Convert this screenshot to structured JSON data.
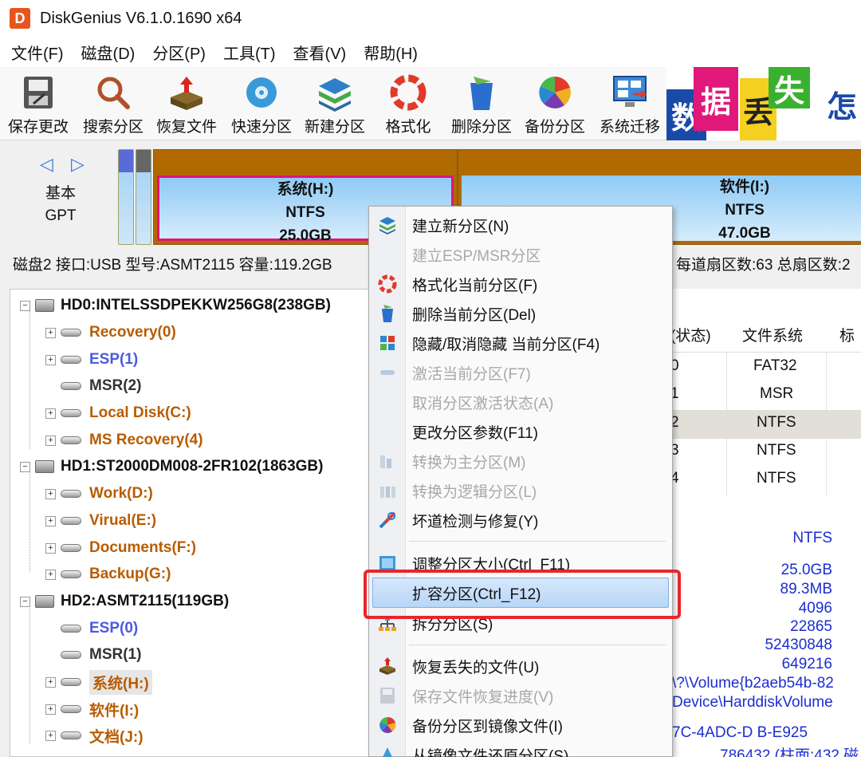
{
  "title": "DiskGenius V6.1.0.1690 x64",
  "menu": [
    "文件(F)",
    "磁盘(D)",
    "分区(P)",
    "工具(T)",
    "查看(V)",
    "帮助(H)"
  ],
  "toolbar": [
    {
      "label": "保存更改",
      "icon": "save-icon"
    },
    {
      "label": "搜索分区",
      "icon": "search-icon"
    },
    {
      "label": "恢复文件",
      "icon": "recover-icon"
    },
    {
      "label": "快速分区",
      "icon": "quick-partition-icon"
    },
    {
      "label": "新建分区",
      "icon": "new-partition-icon"
    },
    {
      "label": "格式化",
      "icon": "format-icon"
    },
    {
      "label": "删除分区",
      "icon": "delete-icon"
    },
    {
      "label": "备份分区",
      "icon": "backup-icon"
    },
    {
      "label": "系统迁移",
      "icon": "migrate-icon"
    }
  ],
  "banner": [
    "数",
    "据",
    "丢",
    "失",
    "怎"
  ],
  "diskmap": {
    "arrows": "◁ ▷",
    "type_line1": "基本",
    "type_line2": "GPT",
    "partitions": [
      {
        "name": "系统(H:)",
        "fs": "NTFS",
        "size": "25.0GB"
      },
      {
        "name": "软件(I:)",
        "fs": "NTFS",
        "size": "47.0GB"
      }
    ]
  },
  "infoline": {
    "left": "磁盘2 接口:USB  型号:ASMT2115  容量:119.2GB",
    "right": "每道扇区数:63  总扇区数:2"
  },
  "tree": [
    {
      "label": "HD0:INTELSSDPEKKW256G8(238GB)",
      "kind": "disk"
    },
    {
      "label": "Recovery(0)",
      "kind": "part",
      "color": "orange"
    },
    {
      "label": "ESP(1)",
      "kind": "part",
      "color": "blue"
    },
    {
      "label": "MSR(2)",
      "kind": "part",
      "color": "dark"
    },
    {
      "label": "Local Disk(C:)",
      "kind": "part",
      "color": "orange"
    },
    {
      "label": "MS Recovery(4)",
      "kind": "part",
      "color": "orange"
    },
    {
      "label": "HD1:ST2000DM008-2FR102(1863GB)",
      "kind": "disk"
    },
    {
      "label": "Work(D:)",
      "kind": "part",
      "color": "orange"
    },
    {
      "label": "Virual(E:)",
      "kind": "part",
      "color": "orange"
    },
    {
      "label": "Documents(F:)",
      "kind": "part",
      "color": "orange"
    },
    {
      "label": "Backup(G:)",
      "kind": "part",
      "color": "orange"
    },
    {
      "label": "HD2:ASMT2115(119GB)",
      "kind": "disk"
    },
    {
      "label": "ESP(0)",
      "kind": "part",
      "color": "blue"
    },
    {
      "label": "MSR(1)",
      "kind": "part",
      "color": "dark"
    },
    {
      "label": "系统(H:)",
      "kind": "part",
      "color": "orange",
      "selected": true
    },
    {
      "label": "软件(I:)",
      "kind": "part",
      "color": "orange"
    },
    {
      "label": "文档(J:)",
      "kind": "part",
      "color": "orange"
    }
  ],
  "table": {
    "headers": [
      "(状态)",
      "文件系统",
      "标"
    ],
    "rows": [
      {
        "idx": "0",
        "fs": "FAT32"
      },
      {
        "idx": "1",
        "fs": "MSR"
      },
      {
        "idx": "2",
        "fs": "NTFS"
      },
      {
        "idx": "3",
        "fs": "NTFS"
      },
      {
        "idx": "4",
        "fs": "NTFS"
      }
    ]
  },
  "details": {
    "fs": "NTFS",
    "values": [
      "25.0GB",
      "89.3MB",
      "4096",
      "22865",
      "52430848",
      "649216"
    ],
    "volume": "\\?\\Volume{b2aeb54b-82",
    "device": "Device\\HarddiskVolume",
    "guid": "7C-4ADC-D",
    "guid_tail": "B-E925",
    "last": "786432 (柱面:432 磁"
  },
  "context_menu": [
    {
      "label": "建立新分区(N)",
      "enabled": true,
      "icon": "new-partition-icon"
    },
    {
      "label": "建立ESP/MSR分区",
      "enabled": false,
      "icon": ""
    },
    {
      "label": "格式化当前分区(F)",
      "enabled": true,
      "icon": "format-icon"
    },
    {
      "label": "删除当前分区(Del)",
      "enabled": true,
      "icon": "delete-icon"
    },
    {
      "label": "隐藏/取消隐藏 当前分区(F4)",
      "enabled": true,
      "icon": "hide-icon"
    },
    {
      "label": "激活当前分区(F7)",
      "enabled": false,
      "icon": "activate-icon"
    },
    {
      "label": "取消分区激活状态(A)",
      "enabled": false,
      "icon": ""
    },
    {
      "label": "更改分区参数(F11)",
      "enabled": true,
      "icon": ""
    },
    {
      "label": "转换为主分区(M)",
      "enabled": false,
      "icon": "primary-icon"
    },
    {
      "label": "转换为逻辑分区(L)",
      "enabled": false,
      "icon": "logical-icon"
    },
    {
      "label": "坏道检测与修复(Y)",
      "enabled": true,
      "icon": "repair-icon"
    },
    {
      "label": "调整分区大小(Ctrl_F11)",
      "enabled": true,
      "icon": "resize-icon"
    },
    {
      "label": "扩容分区(Ctrl_F12)",
      "enabled": true,
      "icon": "",
      "highlighted": true
    },
    {
      "label": "拆分分区(S)",
      "enabled": true,
      "icon": "split-icon"
    },
    {
      "label": "恢复丢失的文件(U)",
      "enabled": true,
      "icon": "recover-icon"
    },
    {
      "label": "保存文件恢复进度(V)",
      "enabled": false,
      "icon": "save-progress-icon"
    },
    {
      "label": "备份分区到镜像文件(I)",
      "enabled": true,
      "icon": "backup-icon"
    },
    {
      "label": "从镜像文件还原分区(S)",
      "enabled": true,
      "icon": "restore-icon"
    }
  ],
  "colors": {
    "accent": "#e8262c",
    "highlight": "#b7d6f7",
    "partition_orange": "#b06a00"
  }
}
